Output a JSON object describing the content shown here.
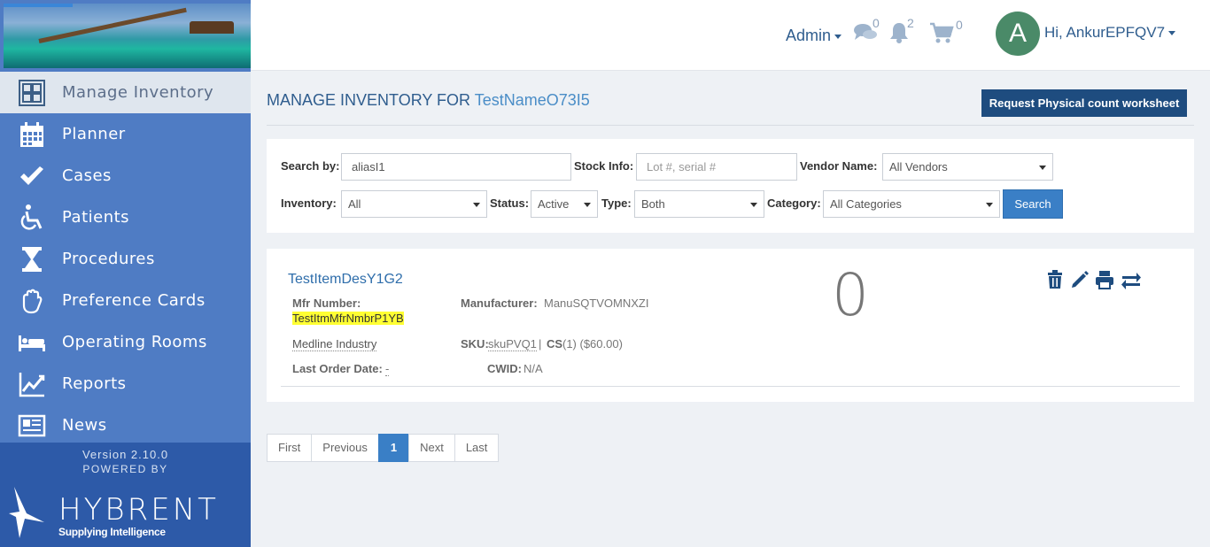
{
  "header": {
    "admin_label": "Admin",
    "messages_count": "0",
    "notifications_count": "2",
    "cart_count": "0",
    "avatar_initial": "A",
    "user_greeting": "Hi, AnkurEPFQV7"
  },
  "sidebar": {
    "items": [
      {
        "label": "Manage Inventory",
        "icon": "inventory-icon"
      },
      {
        "label": "Planner",
        "icon": "calendar-icon"
      },
      {
        "label": "Cases",
        "icon": "checkmark-icon"
      },
      {
        "label": "Patients",
        "icon": "wheelchair-icon"
      },
      {
        "label": "Procedures",
        "icon": "hourglass-icon"
      },
      {
        "label": "Preference Cards",
        "icon": "hand-icon"
      },
      {
        "label": "Operating Rooms",
        "icon": "bed-icon"
      },
      {
        "label": "Reports",
        "icon": "chart-line-icon"
      },
      {
        "label": "News",
        "icon": "newspaper-icon"
      }
    ],
    "version": "Version 2.10.0",
    "powered_by": "POWERED BY",
    "brand": "HYBRENT",
    "tagline": "Supplying Intelligence"
  },
  "page": {
    "title_prefix": "MANAGE INVENTORY FOR",
    "title_link": "TestNameO73I5",
    "request_button": "Request Physical count worksheet"
  },
  "filters": {
    "search_by_label": "Search by:",
    "search_by_value": "aliasI1",
    "stock_info_label": "Stock Info:",
    "stock_info_placeholder": "Lot #, serial #",
    "vendor_label": "Vendor Name:",
    "vendor_value": "All Vendors",
    "inventory_label": "Inventory:",
    "inventory_value": "All",
    "status_label": "Status:",
    "status_value": "Active",
    "type_label": "Type:",
    "type_value": "Both",
    "category_label": "Category:",
    "category_value": "All Categories",
    "search_button": "Search"
  },
  "item": {
    "description": "TestItemDesY1G2",
    "mfr_number_label": "Mfr Number:",
    "mfr_number_value": "TestItmMfrNmbrP1YB",
    "manufacturer_label": "Manufacturer:",
    "manufacturer_value": "ManuSQTVOMNXZI",
    "vendor": "Medline Industry",
    "sku_label": "SKU:",
    "sku_value": "skuPVQ1",
    "separator": "|",
    "uom_label": "CS",
    "uom_detail": "(1) ($60.00)",
    "last_order_label": "Last Order Date:",
    "last_order_value": "-",
    "cwid_label": "CWID:",
    "cwid_value": "N/A",
    "quantity": "0"
  },
  "pagination": {
    "first": "First",
    "previous": "Previous",
    "current": "1",
    "next": "Next",
    "last": "Last"
  }
}
